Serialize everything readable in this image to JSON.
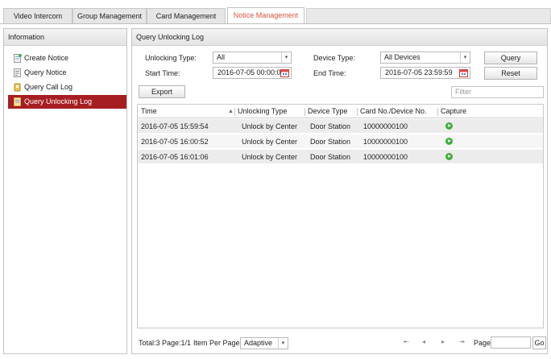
{
  "tabs": [
    {
      "label": "Video Intercom"
    },
    {
      "label": "Group Management"
    },
    {
      "label": "Card Management"
    },
    {
      "label": "Notice Management"
    }
  ],
  "sidebar": {
    "title": "Information",
    "items": [
      {
        "label": "Create Notice",
        "icon": "create-notice-icon"
      },
      {
        "label": "Query Notice",
        "icon": "query-notice-icon"
      },
      {
        "label": "Query Call Log",
        "icon": "call-log-icon"
      },
      {
        "label": "Query Unlocking Log",
        "icon": "unlocking-log-icon"
      }
    ]
  },
  "main": {
    "title": "Query Unlocking Log",
    "form": {
      "unlocking_type_label": "Unlocking Type:",
      "unlocking_type_value": "All",
      "device_type_label": "Device Type:",
      "device_type_value": "All Devices",
      "start_time_label": "Start Time:",
      "start_time_value": "2016-07-05 00:00:00",
      "end_time_label": "End Time:",
      "end_time_value": "2016-07-05 23:59:59",
      "query_label": "Query",
      "reset_label": "Reset",
      "export_label": "Export",
      "filter_placeholder": "Filter"
    },
    "table": {
      "columns": [
        "Time",
        "Unlocking Type",
        "Device Type",
        "Card No./Device No.",
        "Capture"
      ],
      "rows": [
        {
          "time": "2016-07-05 15:59:54",
          "unlocking_type": "Unlock by Center",
          "device_type": "Door Station",
          "card_no": "10000000100"
        },
        {
          "time": "2016-07-05 16:00:52",
          "unlocking_type": "Unlock by Center",
          "device_type": "Door Station",
          "card_no": "10000000100"
        },
        {
          "time": "2016-07-05 16:01:06",
          "unlocking_type": "Unlock by Center",
          "device_type": "Door Station",
          "card_no": "10000000100"
        }
      ]
    },
    "footer": {
      "total_text": "Total:3",
      "page_text": "Page:1/1",
      "per_page_label": "Item Per Page:",
      "per_page_value": "Adaptive",
      "page_label": "Page",
      "go_label": "Go"
    }
  },
  "colors": {
    "active_tab_text": "#d8533f",
    "active_nav_bg": "#a61e22",
    "capture_icon": "#3fae3a"
  }
}
